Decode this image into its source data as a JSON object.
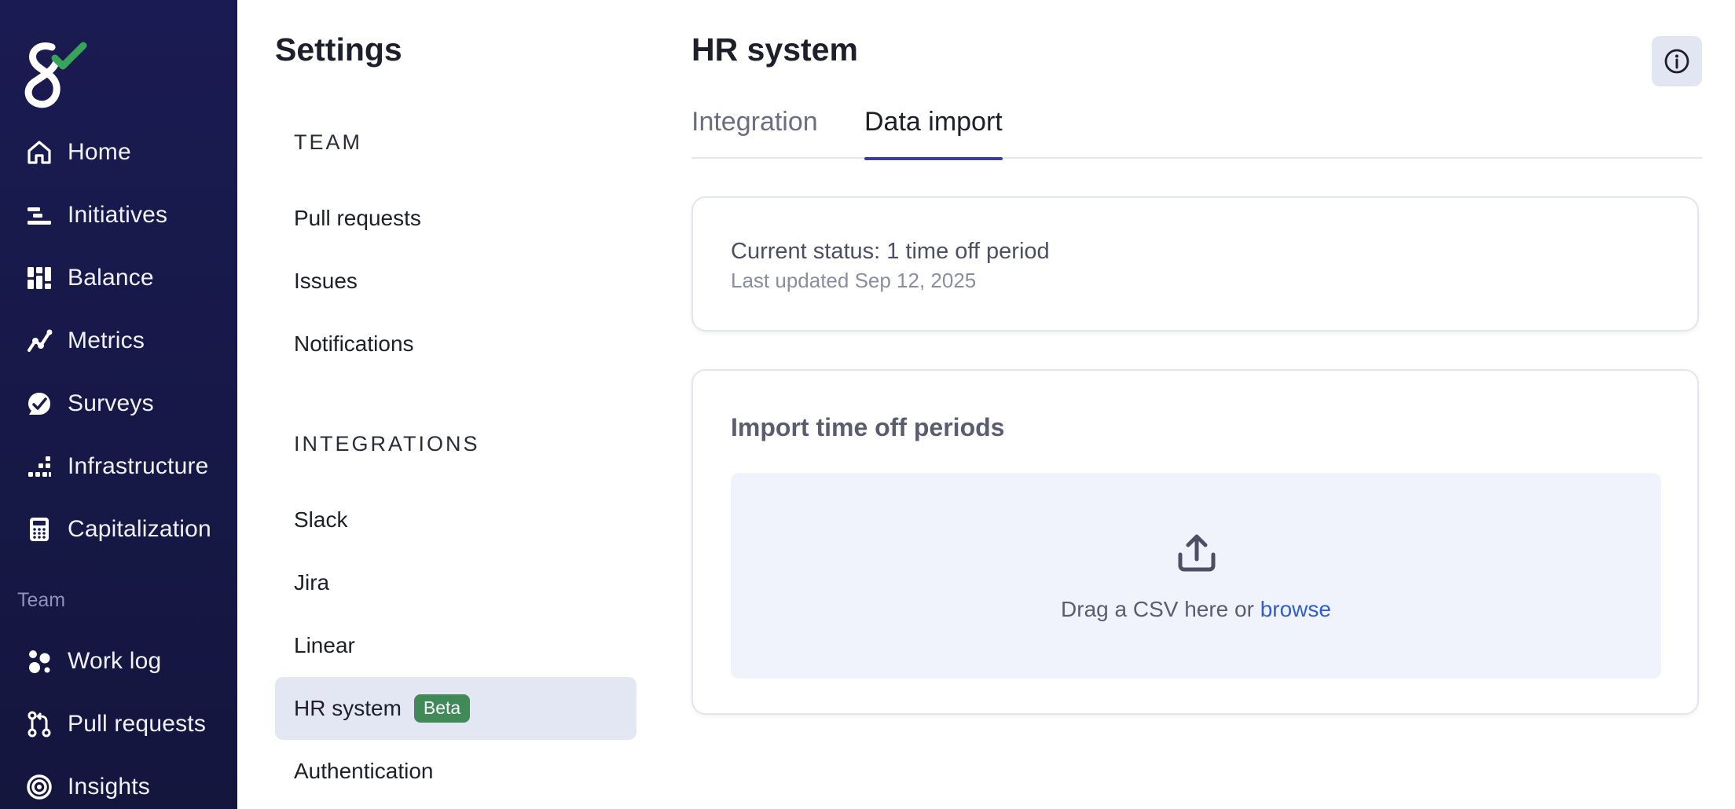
{
  "colors": {
    "sidebar_bg": "#1a1b52",
    "logo_check": "#3aa35b",
    "active_item_bg": "#e3e7f4",
    "beta_badge": "#3f8a57",
    "tab_underline": "#3a3f9e",
    "link": "#2f5fcf"
  },
  "nav": {
    "items": [
      {
        "label": "Home",
        "icon": "home-icon"
      },
      {
        "label": "Initiatives",
        "icon": "initiatives-icon"
      },
      {
        "label": "Balance",
        "icon": "balance-icon"
      },
      {
        "label": "Metrics",
        "icon": "metrics-icon"
      },
      {
        "label": "Surveys",
        "icon": "surveys-icon"
      },
      {
        "label": "Infrastructure",
        "icon": "infrastructure-icon"
      },
      {
        "label": "Capitalization",
        "icon": "calculator-icon"
      }
    ],
    "team_section": "Team",
    "team_items": [
      {
        "label": "Work log",
        "icon": "work-log-icon"
      },
      {
        "label": "Pull requests",
        "icon": "pull-request-icon"
      },
      {
        "label": "Insights",
        "icon": "insights-icon"
      }
    ]
  },
  "settings": {
    "title": "Settings",
    "team_group": "TEAM",
    "team_items": [
      "Pull requests",
      "Issues",
      "Notifications"
    ],
    "integrations_group": "INTEGRATIONS",
    "integration_items": [
      "Slack",
      "Jira",
      "Linear",
      "HR system",
      "Authentication"
    ],
    "active_item": "HR system",
    "beta_badge": "Beta"
  },
  "main": {
    "title": "HR system",
    "tabs": [
      {
        "label": "Integration",
        "active": false
      },
      {
        "label": "Data import",
        "active": true
      }
    ],
    "status": {
      "current": "Current status: 1 time off period",
      "updated": "Last updated Sep 12, 2025"
    },
    "import": {
      "title": "Import time off periods",
      "drop_text": "Drag a CSV here or ",
      "browse_label": "browse",
      "icon": "upload-icon"
    },
    "info_icon": "info-icon"
  }
}
